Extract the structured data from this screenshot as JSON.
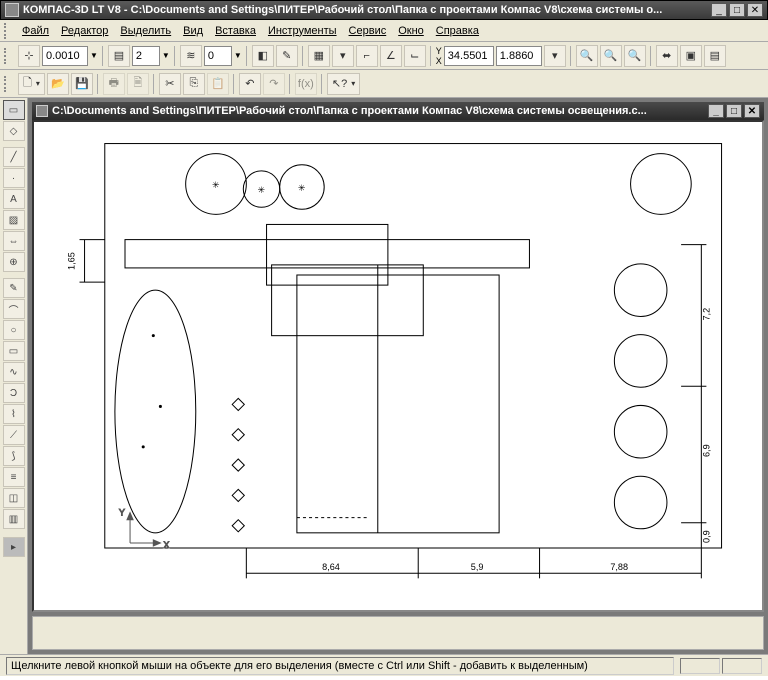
{
  "app": {
    "title": "КОМПАС-3D LT V8 - C:\\Documents and Settings\\ПИТЕР\\Рабочий стол\\Папка с проектами Компас V8\\схема системы о..."
  },
  "menu": {
    "items": [
      "Файл",
      "Редактор",
      "Выделить",
      "Вид",
      "Вставка",
      "Инструменты",
      "Сервис",
      "Окно",
      "Справка"
    ]
  },
  "toolbar1": {
    "step_value": "0.0010",
    "layer_value": "2",
    "style_value": "0",
    "coord_label_x": "Y",
    "coord_label_y": "X",
    "coord_x": "34.5501",
    "coord_y": "1.8860"
  },
  "document": {
    "title": "C:\\Documents and Settings\\ПИТЕР\\Рабочий стол\\Папка с проектами Компас V8\\схема системы освещения.с..."
  },
  "drawing": {
    "dims": {
      "left_v": "1,65",
      "h1": "8,64",
      "h2": "5,9",
      "h3": "7,88",
      "v1": "7,2",
      "v2": "6,9",
      "v3": "0,9"
    },
    "origin": {
      "x_label": "X",
      "y_label": "Y"
    }
  },
  "status": {
    "text": "Щелкните левой кнопкой мыши на объекте для его выделения (вместе с Ctrl или Shift - добавить к выделенным)"
  }
}
